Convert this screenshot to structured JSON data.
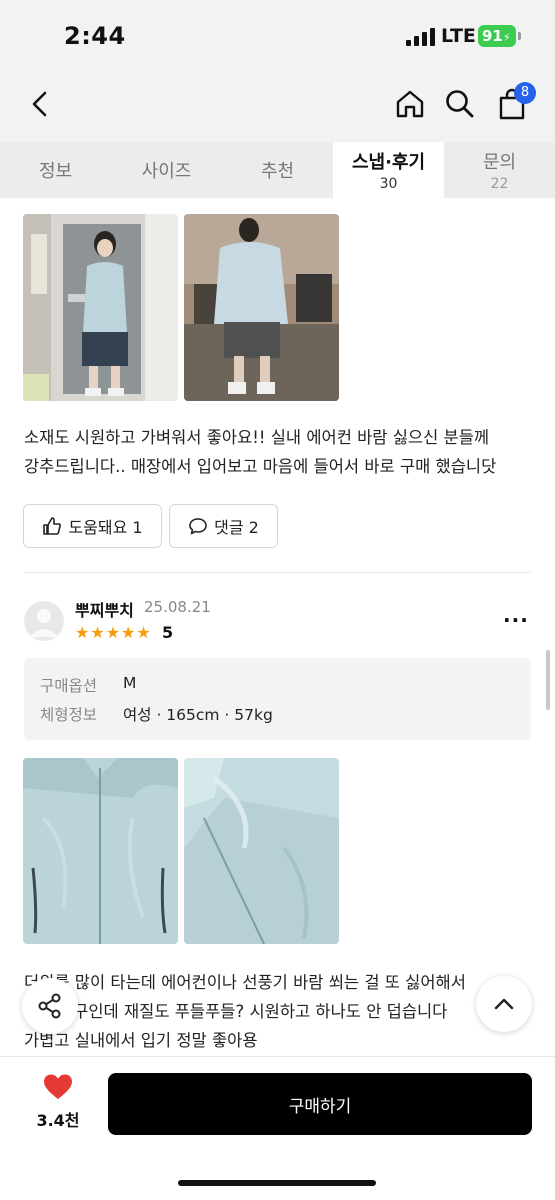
{
  "status_bar": {
    "time": "2:44",
    "network": "LTE",
    "battery": "91"
  },
  "top_nav": {
    "back_icon": "chevron-left-icon",
    "home_icon": "home-icon",
    "search_icon": "search-icon",
    "cart_icon": "shopping-bag-icon",
    "cart_badge": "8"
  },
  "tabs": [
    {
      "label": "정보",
      "count": ""
    },
    {
      "label": "사이즈",
      "count": ""
    },
    {
      "label": "추천",
      "count": ""
    },
    {
      "label": "스냅·후기",
      "count": "30",
      "active": true
    },
    {
      "label": "문의",
      "count": "22"
    }
  ],
  "review1": {
    "text_line1": "소재도 시원하고 가벼워서 좋아요!! 실내 에어컨 바람 싫으신 분들께",
    "text_line2": "강추드립니다.. 매장에서 입어보고 마음에 들어서 바로 구매 했습니닷",
    "helpful_label": "도움돼요 1",
    "comment_label": "댓글 2"
  },
  "review2": {
    "username": "뿌찌뿌치",
    "date": "25.08.21",
    "rating": "5",
    "option_label": "구매옵션",
    "option_value": "M",
    "body_label": "체형정보",
    "body_value": "여성 · 165cm · 57kg",
    "text_line1": "더위를 많이 타는데 에어컨이나 선풍기 바람 쐬는 걸 또 싫어해서",
    "text_line2": "친구인데 재질도 푸들푸들? 시원하고 하나도 안 덥습니다",
    "text_line3": "가볍고 실내에서 입기 정말 좋아용"
  },
  "colors": {
    "accent_blue": "#2563eb",
    "star": "#f59e0b",
    "like_heart": "#e53935",
    "jacket": "#b9d2d8"
  },
  "bottom_bar": {
    "like_count": "3.4천",
    "buy_label": "구매하기"
  }
}
